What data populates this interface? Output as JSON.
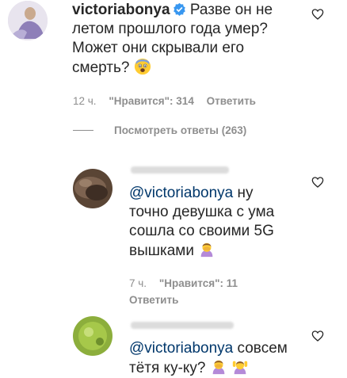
{
  "comments": {
    "main": {
      "username": "victoriabonya",
      "text_line1": "Разве он не",
      "text_line2": "летом прошлого года умер?",
      "text_line3": "Может они скрывали его",
      "text_line4": "смерть?",
      "time": "12 ч.",
      "likes": "\"Нравится\": 314",
      "reply": "Ответить",
      "view_replies": "Посмотреть ответы (263)"
    },
    "reply1": {
      "mention": "@victoriabonya",
      "text_line1_rest": " ну",
      "text_line2": "точно девушка с ума",
      "text_line3": "сошла со своими 5G",
      "text_line4": "вышками",
      "time": "7 ч.",
      "likes": "\"Нравится\": 11",
      "reply": "Ответить"
    },
    "reply2": {
      "mention": "@victoriabonya",
      "text_line1_rest": " совсем",
      "text_line2": "тётя ку-ку?"
    }
  },
  "colors": {
    "text": "#262626",
    "meta": "#8e8e8e",
    "mention": "#00376b",
    "verified": "#3897f0"
  }
}
